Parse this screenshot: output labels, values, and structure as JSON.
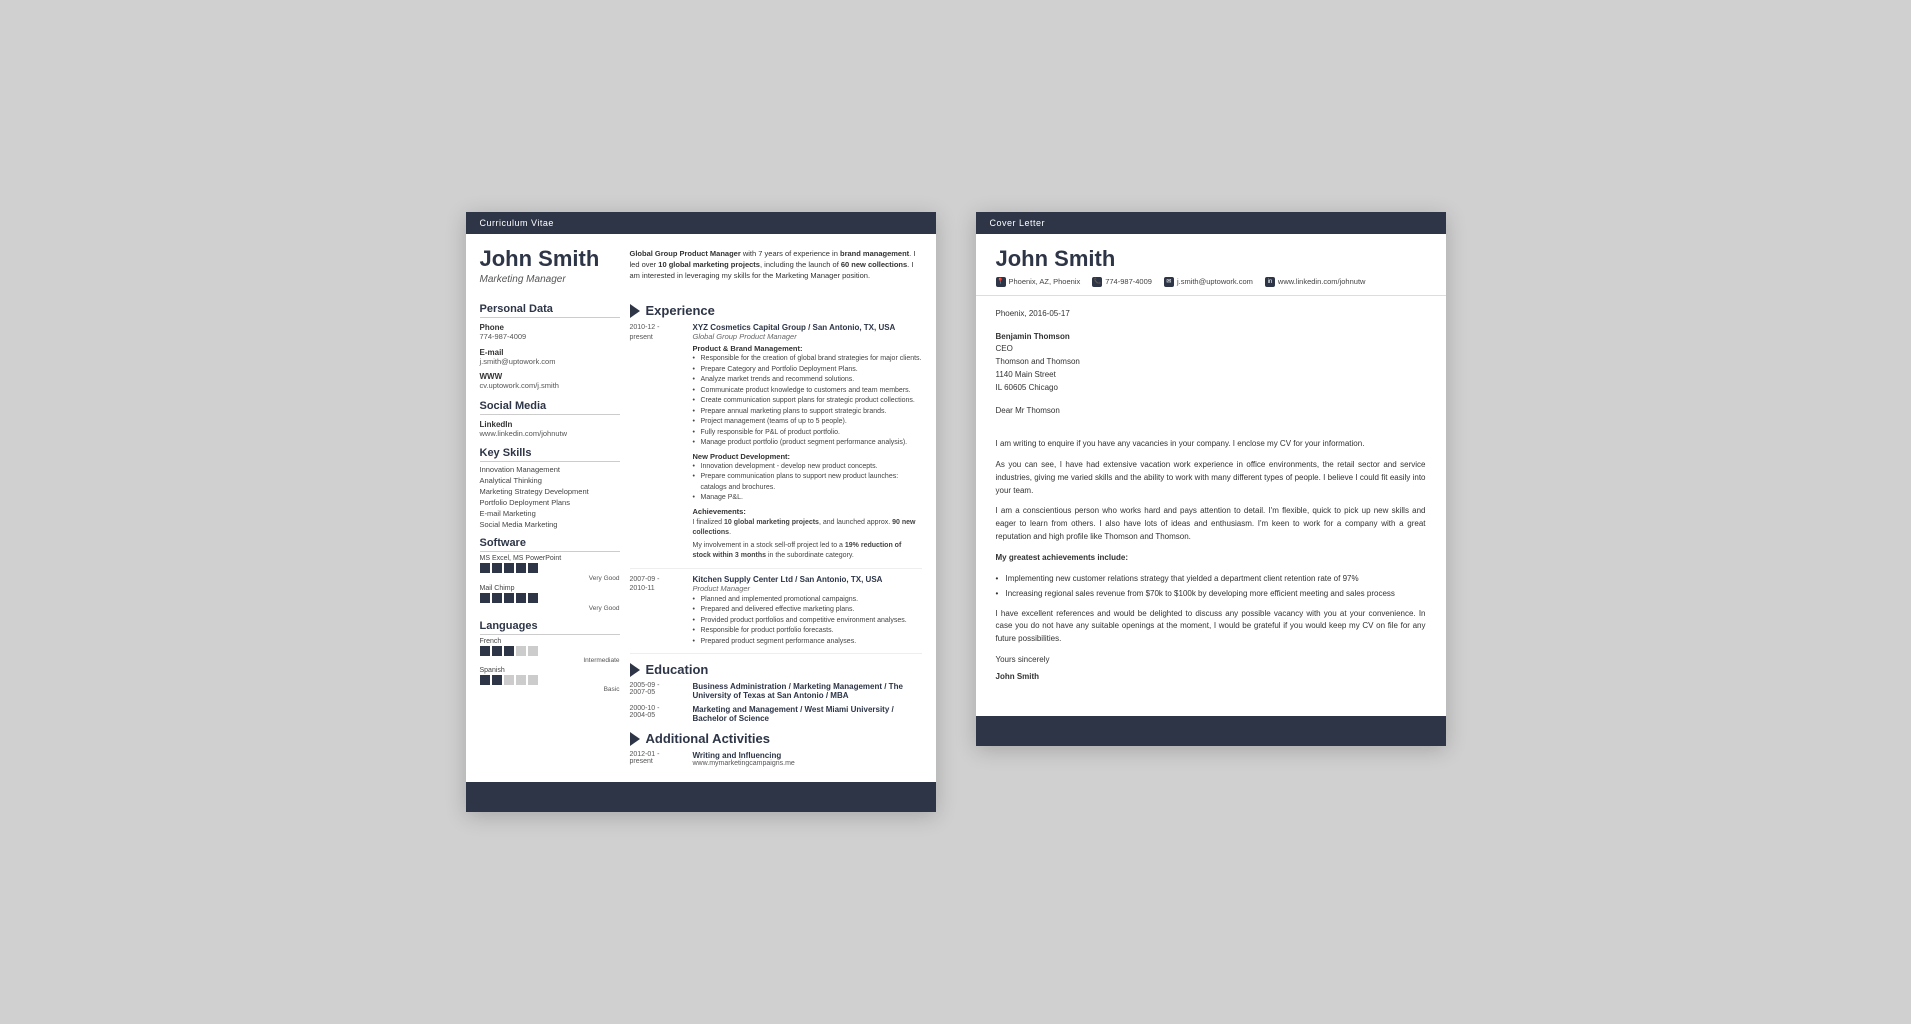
{
  "cv": {
    "header_bar": "Curriculum Vitae",
    "name": "John Smith",
    "title": "Marketing Manager",
    "summary": "Global Group Product Manager with 7 years of experience in brand management. I led over 10 global marketing projects, including the launch of 60 new collections. I am interested in leveraging my skills for the Marketing Manager position.",
    "personal_data": {
      "section_title": "Personal Data",
      "phone_label": "Phone",
      "phone": "774-987-4009",
      "email_label": "E-mail",
      "email": "j.smith@uptowork.com",
      "www_label": "WWW",
      "www": "cv.uptowork.com/j.smith"
    },
    "social_media": {
      "section_title": "Social Media",
      "linkedin_label": "LinkedIn",
      "linkedin": "www.linkedin.com/johnutw"
    },
    "key_skills": {
      "section_title": "Key Skills",
      "skills": [
        "Innovation Management",
        "Analytical Thinking",
        "Marketing Strategy Development",
        "Portfolio Deployment Plans",
        "E-mail Marketing",
        "Social Media Marketing"
      ]
    },
    "software": {
      "section_title": "Software",
      "items": [
        {
          "name": "MS Excel, MS PowerPoint",
          "level": 5,
          "max": 5,
          "label": "Very Good"
        },
        {
          "name": "Mail Chimp",
          "level": 5,
          "max": 5,
          "label": "Very Good"
        }
      ]
    },
    "languages": {
      "section_title": "Languages",
      "items": [
        {
          "name": "French",
          "level": 3,
          "max": 5,
          "label": "Intermediate"
        },
        {
          "name": "Spanish",
          "level": 2,
          "max": 5,
          "label": "Basic"
        }
      ]
    },
    "experience": {
      "section_title": "Experience",
      "entries": [
        {
          "dates": "2010-12 - present",
          "company": "XYZ Cosmetics Capital Group / San Antonio, TX, USA",
          "position": "Global Group Product Manager",
          "subsections": [
            {
              "title": "Product & Brand Management:",
              "bullets": [
                "Responsible for the creation of global brand strategies for major clients.",
                "Prepare Category and Portfolio Deployment Plans.",
                "Analyze market trends and recommend solutions.",
                "Communicate product knowledge to customers and team members.",
                "Create communication support plans for strategic product collections.",
                "Prepare annual marketing plans to support strategic brands.",
                "Project management (teams of up to 5 people).",
                "Fully responsible for P&L of product portfolio.",
                "Manage product portfolio (product segment performance analysis)."
              ]
            },
            {
              "title": "New Product Development:",
              "bullets": [
                "Innovation development - develop new product concepts.",
                "Prepare communication plans to support new product launches: catalogs and brochures.",
                "Manage P&L."
              ]
            }
          ],
          "achievements_title": "Achievements:",
          "achievements": [
            "I finalized 10 global marketing projects, and launched approx. 90 new collections.",
            "My involvement in a stock sell-off project led to a 19% reduction of stock within 3 months in the subordinate category."
          ]
        },
        {
          "dates": "2007-09 - 2010-11",
          "company": "Kitchen Supply Center Ltd / San Antonio, TX, USA",
          "position": "Product Manager",
          "bullets": [
            "Planned and implemented promotional campaigns.",
            "Prepared and delivered effective marketing plans.",
            "Provided product portfolios and competitive environment analyses.",
            "Responsible for product portfolio forecasts.",
            "Prepared product segment performance analyses."
          ]
        }
      ]
    },
    "education": {
      "section_title": "Education",
      "entries": [
        {
          "dates": "2005-09 - 2007-05",
          "title": "Business Administration / Marketing Management / The University of Texas at San Antonio / MBA"
        },
        {
          "dates": "2000-10 - 2004-05",
          "title": "Marketing and Management / West Miami University / Bachelor of Science"
        }
      ]
    },
    "additional_activities": {
      "section_title": "Additional Activities",
      "entries": [
        {
          "dates": "2012-01 - present",
          "title": "Writing and Influencing",
          "detail": "www.mymarketingcampaigns.me"
        }
      ]
    }
  },
  "cover_letter": {
    "header_bar": "Cover Letter",
    "name": "John Smith",
    "contacts": [
      {
        "icon": "📍",
        "text": "Phoenix, AZ, Phoenix"
      },
      {
        "icon": "📞",
        "text": "774-987-4009"
      },
      {
        "icon": "✉",
        "text": "j.smith@uptowork.com"
      },
      {
        "icon": "🔗",
        "text": "www.linkedin.com/johnutw"
      }
    ],
    "date": "Phoenix, 2016-05-17",
    "recipient": {
      "name": "Benjamin Thomson",
      "role": "CEO",
      "company": "Thomson and Thomson",
      "address1": "1140 Main Street",
      "address2": "IL 60605 Chicago"
    },
    "salutation": "Dear Mr Thomson",
    "paragraphs": [
      "I am writing to enquire if you have any vacancies in your company. I enclose my CV for your information.",
      "As you can see, I have had extensive vacation work experience in office environments, the retail sector and service industries, giving me varied skills and the ability to work with many different types of people. I believe I could fit easily into your team.",
      "I am a conscientious person who works hard and pays attention to detail. I'm flexible, quick to pick up new skills and eager to learn from others. I also have lots of ideas and enthusiasm. I'm keen to work for a company with a great reputation and high profile like Thomson and Thomson."
    ],
    "achievements_header": "My greatest achievements include:",
    "achievements": [
      "Implementing new customer relations strategy that yielded a department client retention rate of 97%",
      "Increasing regional sales revenue from $70k to $100k by developing more efficient meeting and sales process"
    ],
    "closing_paragraph": "I have excellent references and would be delighted to discuss any possible vacancy with you at your convenience. In case you do not have any suitable openings at the moment, I would be grateful if you would keep my CV on file for any future possibilities.",
    "valediction": "Yours sincerely",
    "signature": "John Smith"
  }
}
